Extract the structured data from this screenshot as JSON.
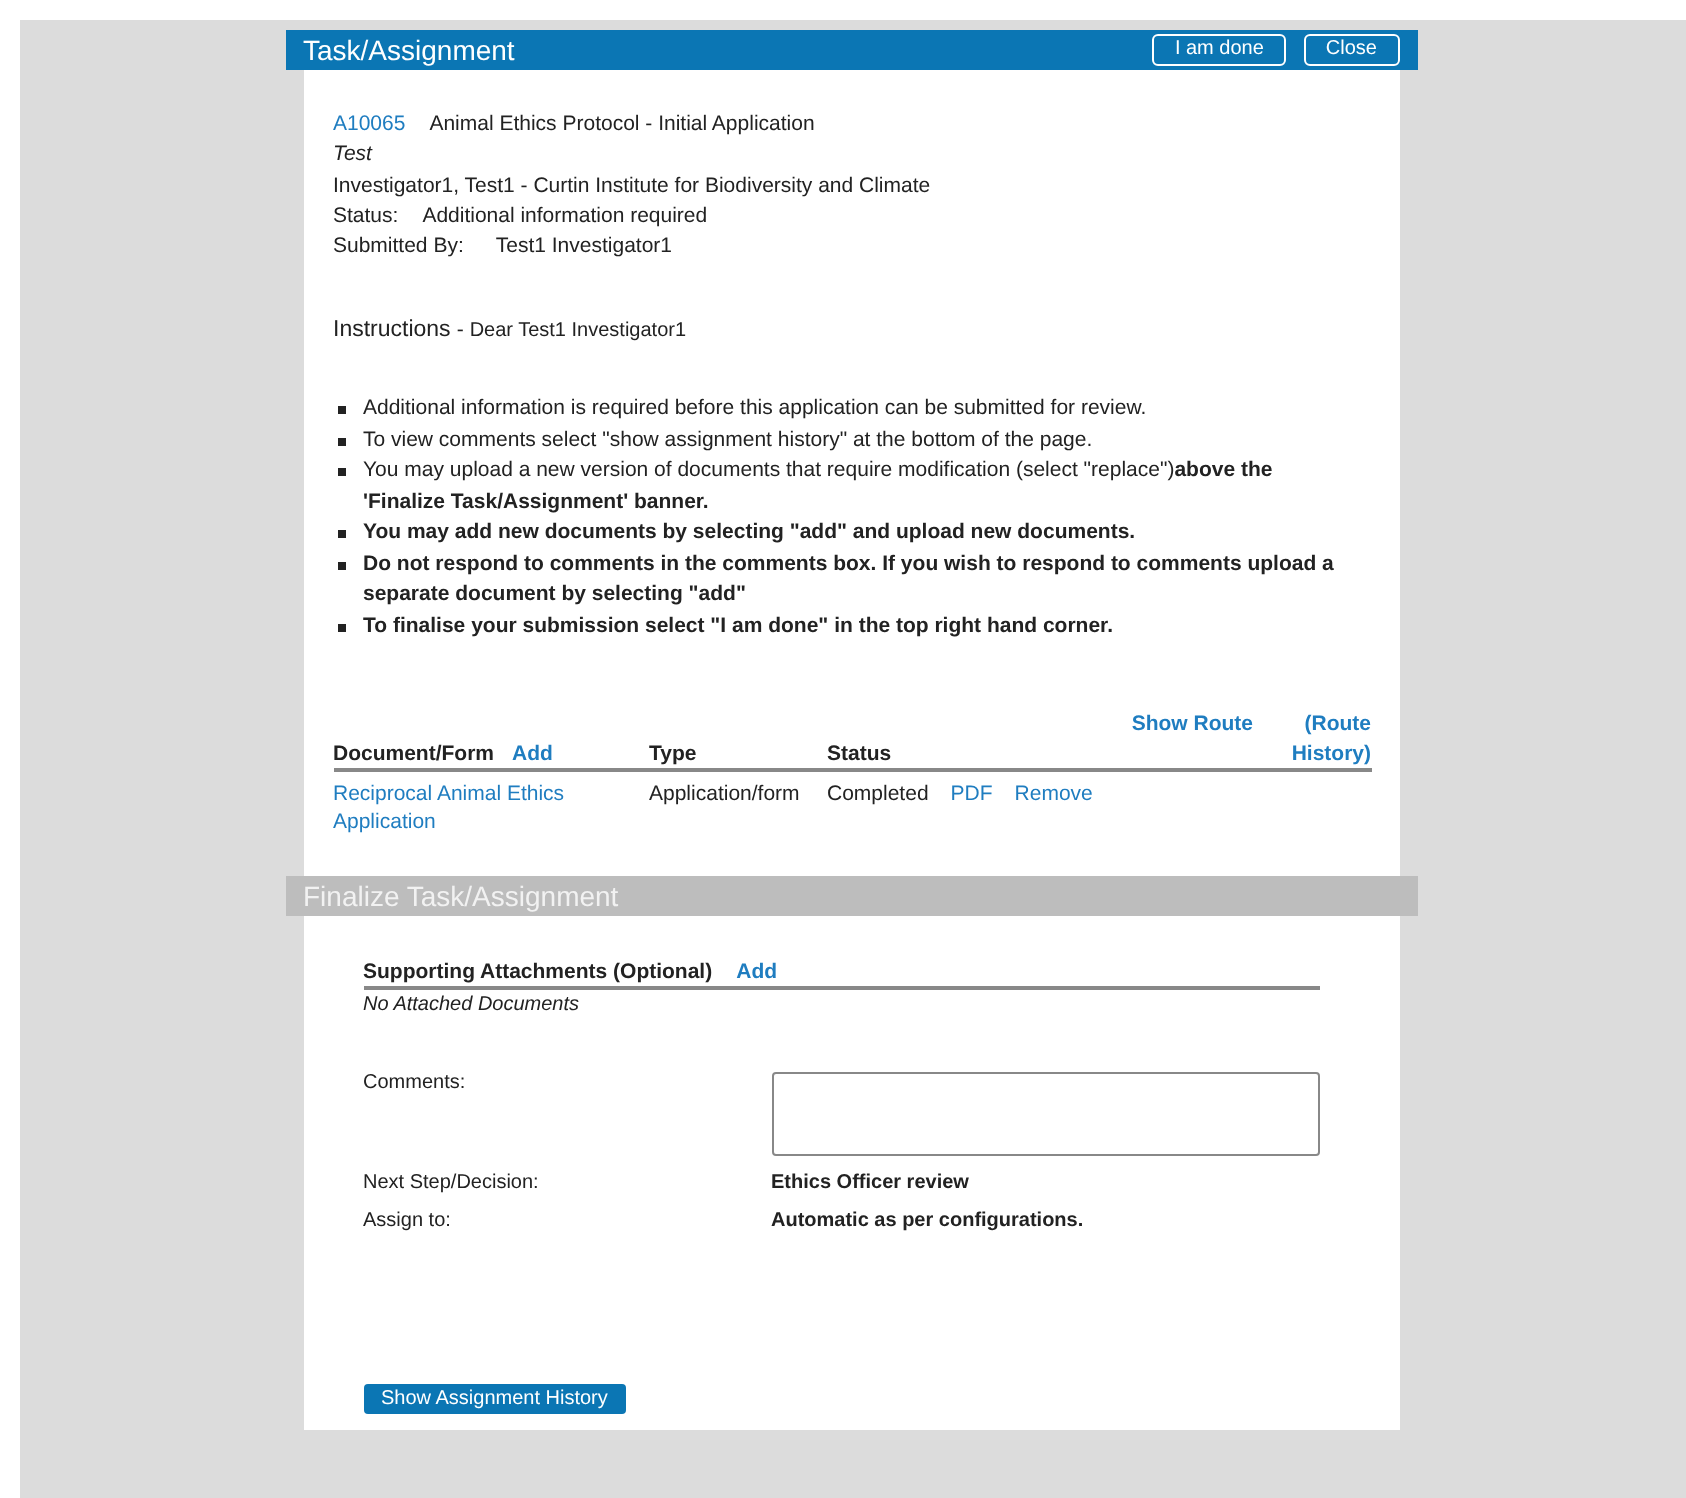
{
  "header": {
    "title": "Task/Assignment",
    "buttons": [
      "I am done",
      "Close"
    ]
  },
  "summary": {
    "id": "A10065",
    "name": "Animal Ethics Protocol - Initial Application",
    "subtitle": "Test",
    "investigator": "Investigator1, Test1 - Curtin Institute for Biodiversity and Climate",
    "status_label": "Status:",
    "status": "Additional information required",
    "submitted_label": "Submitted By:",
    "submitted_by": "Test1 Investigator1"
  },
  "instructions": {
    "label": "Instructions",
    "separator": "-",
    "greeting": "Dear Test1 Investigator1",
    "items": [
      {
        "text": "Additional information is required before this application can be submitted for review."
      },
      {
        "text": "To view comments select \"show assignment history\" at the bottom of the page."
      },
      {
        "text": "You may upload a new version of documents that require modification (select \"replace\")**above the 'Finalize Task/Assignment' banner.**"
      },
      {
        "text": "**You may add new documents by selecting \"add\" and upload new documents.**"
      },
      {
        "text": "**Do not respond to comments in the comments box. If you wish to respond to comments upload a separate document by selecting \"add\"**"
      },
      {
        "text": "**To finalise your submission select \"I am done\" in the top right hand corner.**"
      }
    ]
  },
  "documents": {
    "show_route": "Show Route",
    "route_history": "(Route History)",
    "columns": [
      "Document/Form",
      "Type",
      "Status"
    ],
    "add": "Add",
    "rows": [
      {
        "document": "Reciprocal Animal Ethics Application",
        "type": "Application/form",
        "status": "Completed",
        "links": [
          "PDF",
          "Remove"
        ]
      }
    ]
  },
  "finalize": {
    "title": "Finalize Task/Assignment",
    "attachments_label": "Supporting Attachments (Optional)",
    "attachments_add": "Add",
    "no_attachments": "No Attached Documents",
    "comments_label": "Comments:",
    "next_step_label": "Next Step/Decision:",
    "next_step": "Ethics Officer review",
    "assign_label": "Assign to:",
    "assign": "Automatic as per configurations.",
    "history_button": "Show Assignment History"
  }
}
